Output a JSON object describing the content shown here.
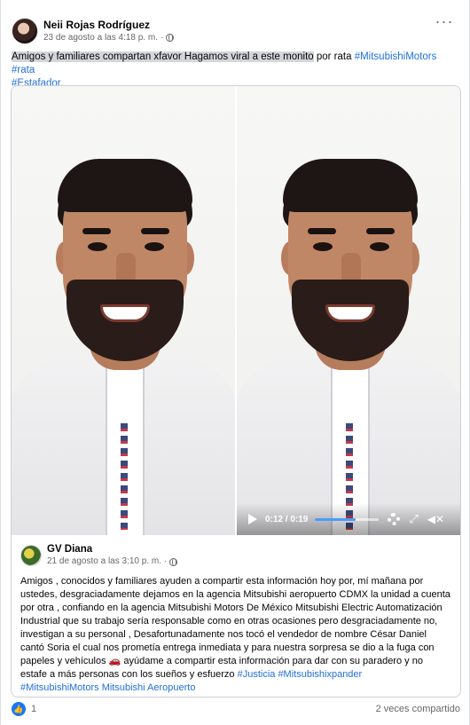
{
  "post": {
    "author_name": "Neii Rojas Rodríguez",
    "timestamp": "23 de agosto a las 4:18 p. m.",
    "dot": "·",
    "more_label": "···",
    "text_highlighted": "Amigos y familiares compartan xfavor  Hagamos viral a este monito",
    "text_rest": " por rata ",
    "hashtag_1": "#MitsubishiMotors",
    "hashtag_2": "#rata",
    "hashtag_3": "#Estafador"
  },
  "video": {
    "current_time": "0:12 / 0:19",
    "progress": 0.63,
    "icons": [
      "play-icon",
      "gear-icon",
      "expand-icon",
      "volume-icon"
    ]
  },
  "shared": {
    "author_name": "GV Diana",
    "timestamp": "21 de agosto a las 3:10 p. m.",
    "dot": "·",
    "text": "Amigos , conocidos y familiares ayuden a compartir esta información hoy por, mí mañana por ustedes, desgraciadamente dejamos en la agencia Mitsubishi aeropuerto CDMX la unidad a cuenta por otra , confiando en la agencia Mitsubishi Motors De México Mitsubishi Electric Automatización Industrial que su trabajo sería responsable como en otras ocasiones pero desgraciadamente no, investigan a su personal , Desafortunadamente nos tocó el vendedor de nombre César Daniel cantó Soria el cual nos prometía entrega inmediata y para nuestra sorpresa se dio a la fuga con papeles y vehículos 🚗 ayúdame a compartir esta información para dar con su paradero y no estafe a más personas con los sueños y esfuerzo ",
    "hashtag_1": "#Justicia",
    "hashtag_2": "#Mitsubishixpander",
    "hashtag_3": "#MitsubishiMotors",
    "hashtag_4": "Mitsubishi Aeropuerto"
  },
  "footer": {
    "like_count": "1",
    "shares": "2 veces compartido"
  },
  "colors": {
    "link": "#216fdb",
    "like_blue": "#1877f2",
    "meta_gray": "#65676b"
  }
}
